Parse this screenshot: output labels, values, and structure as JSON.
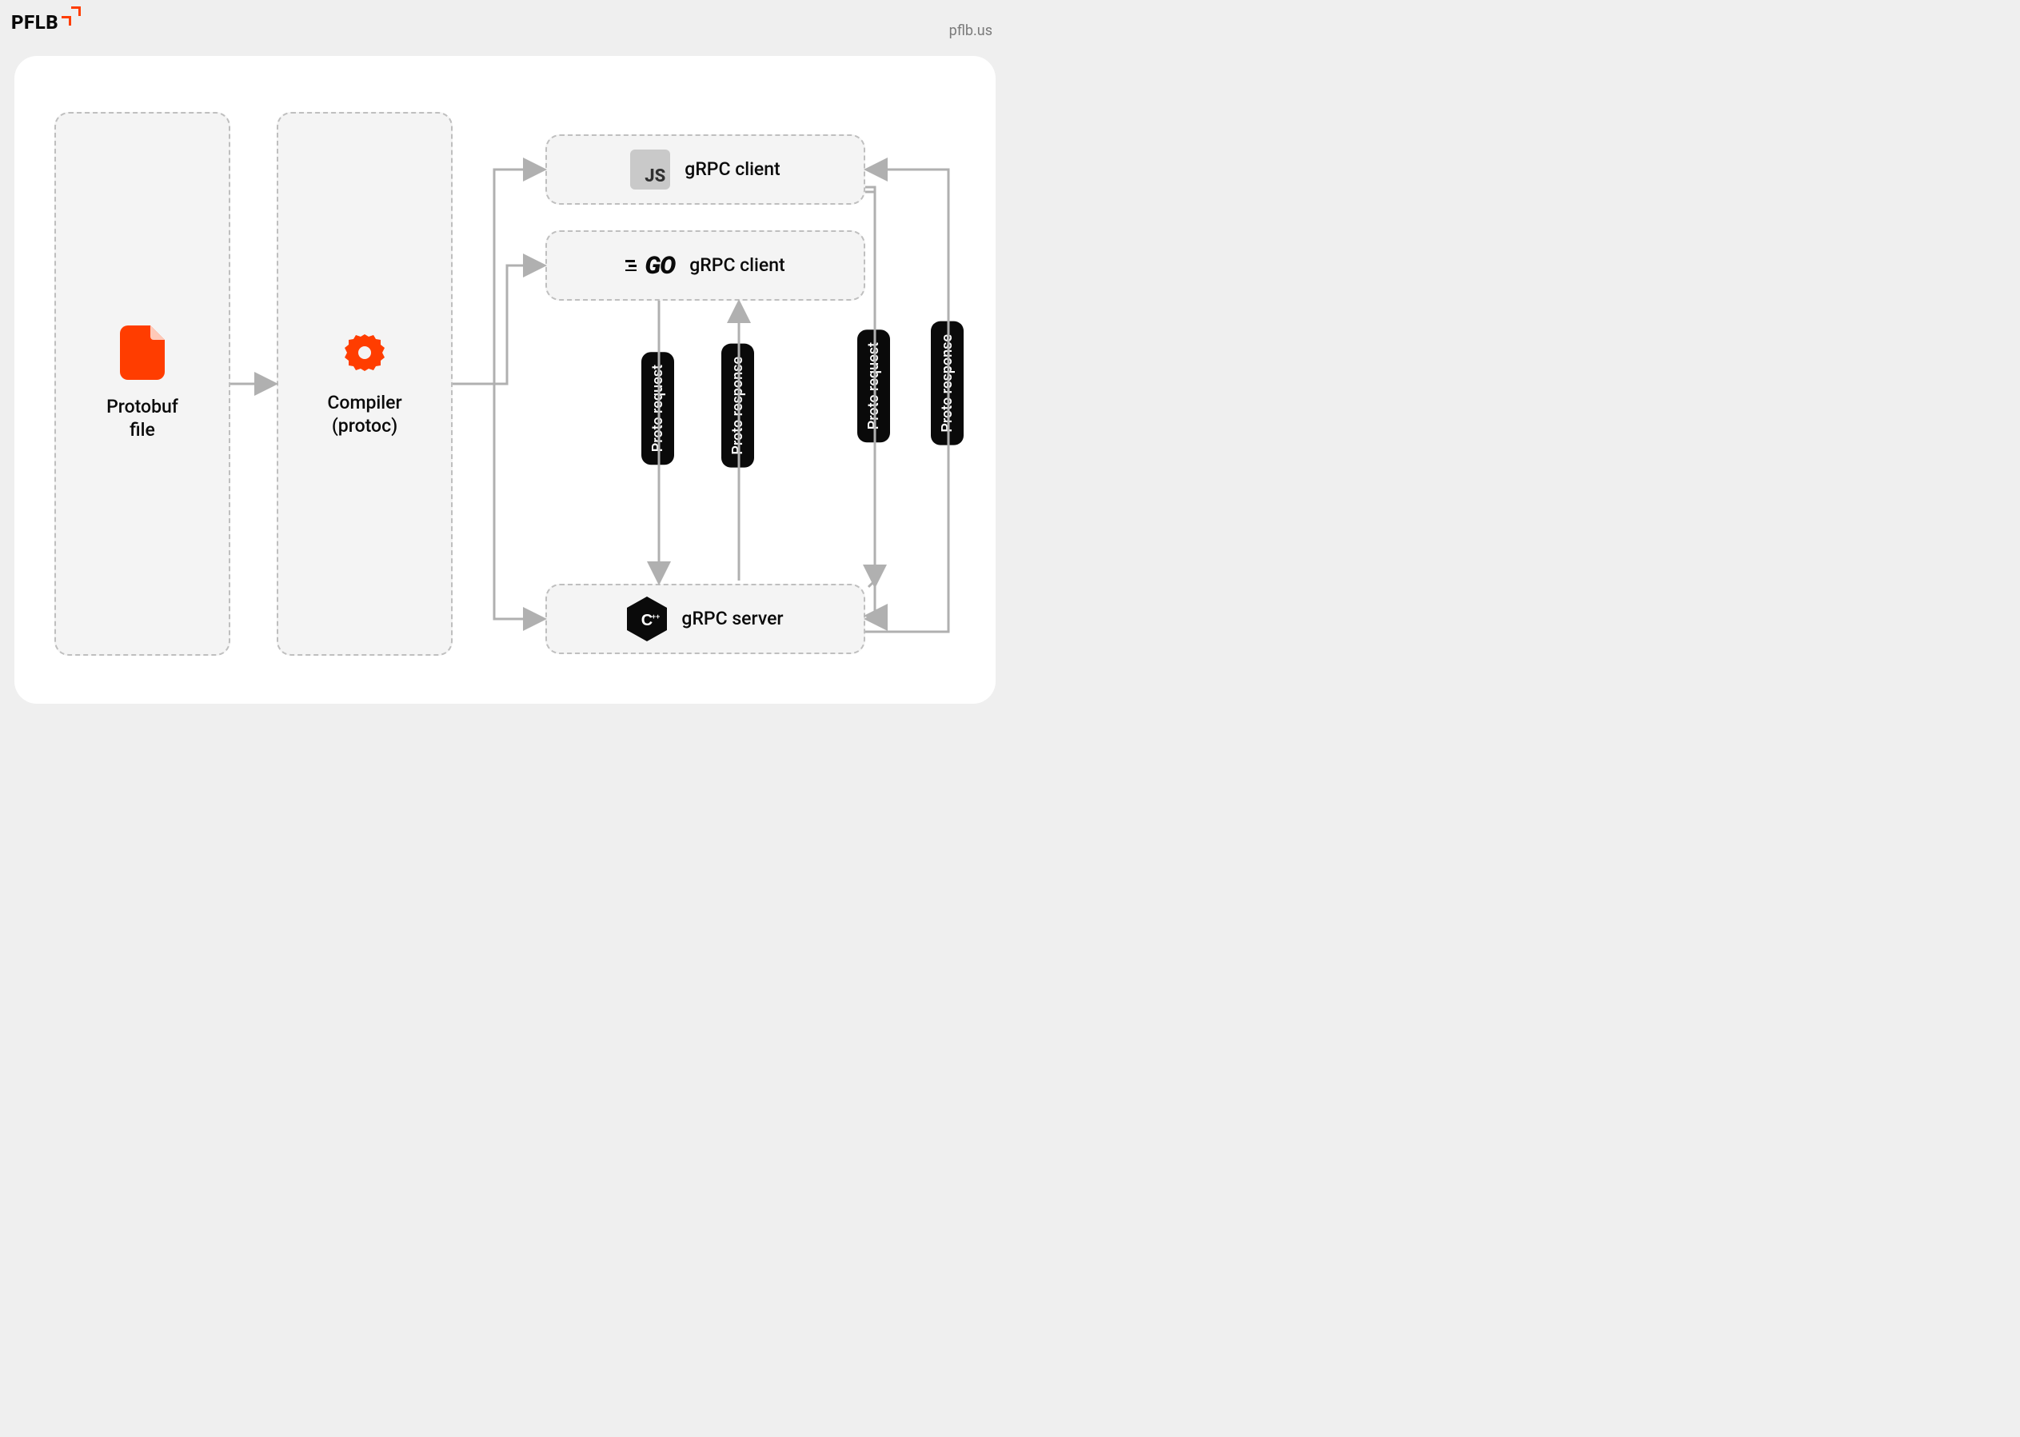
{
  "brand": {
    "name": "PFLB",
    "url": "pflb.us"
  },
  "nodes": {
    "protobuf": {
      "label": "Protobuf\nfile"
    },
    "compiler": {
      "label": "Compiler\n(protoc)"
    },
    "js_client": {
      "label": "gRPC client",
      "icon_text": "JS"
    },
    "go_client": {
      "label": "gRPC client",
      "icon_text": "GO"
    },
    "server": {
      "label": "gRPC server"
    }
  },
  "edge_labels": {
    "req1": "Proto request",
    "res1": "Proto response",
    "req2": "Proto request",
    "res2": "Proto response"
  },
  "colors": {
    "accent": "#FF3D00",
    "stroke": "#B0B0B0",
    "black": "#0A0A0A"
  }
}
